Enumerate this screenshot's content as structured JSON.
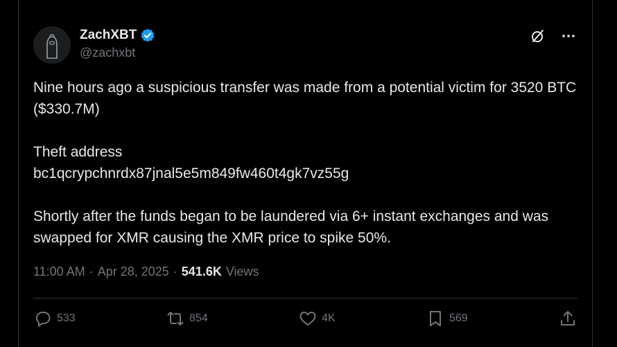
{
  "tweet": {
    "author": {
      "name": "ZachXBT",
      "handle": "@zachxbt",
      "verified_color": "#1d9bf0"
    },
    "paragraphs": [
      "Nine hours ago a suspicious transfer was made from a potential victim for 3520 BTC ($330.7M)",
      "Theft address",
      "bc1qcrypchnrdx87jnal5e5m849fw460t4gk7vz55g",
      "Shortly after the funds began to be laundered via 6+ instant exchanges and was swapped for XMR causing the XMR price to spike 50%."
    ],
    "meta": {
      "time": "11:00 AM",
      "separator": "·",
      "date": "Apr 28, 2025",
      "views_count": "541.6K",
      "views_label": "Views"
    },
    "stats": {
      "replies": "533",
      "reposts": "854",
      "likes": "4K",
      "bookmarks": "569"
    }
  },
  "icons": {
    "top": [
      "grok-icon",
      "more-icon"
    ],
    "actions": [
      "reply-icon",
      "repost-icon",
      "like-icon",
      "bookmark-icon",
      "share-icon"
    ]
  }
}
